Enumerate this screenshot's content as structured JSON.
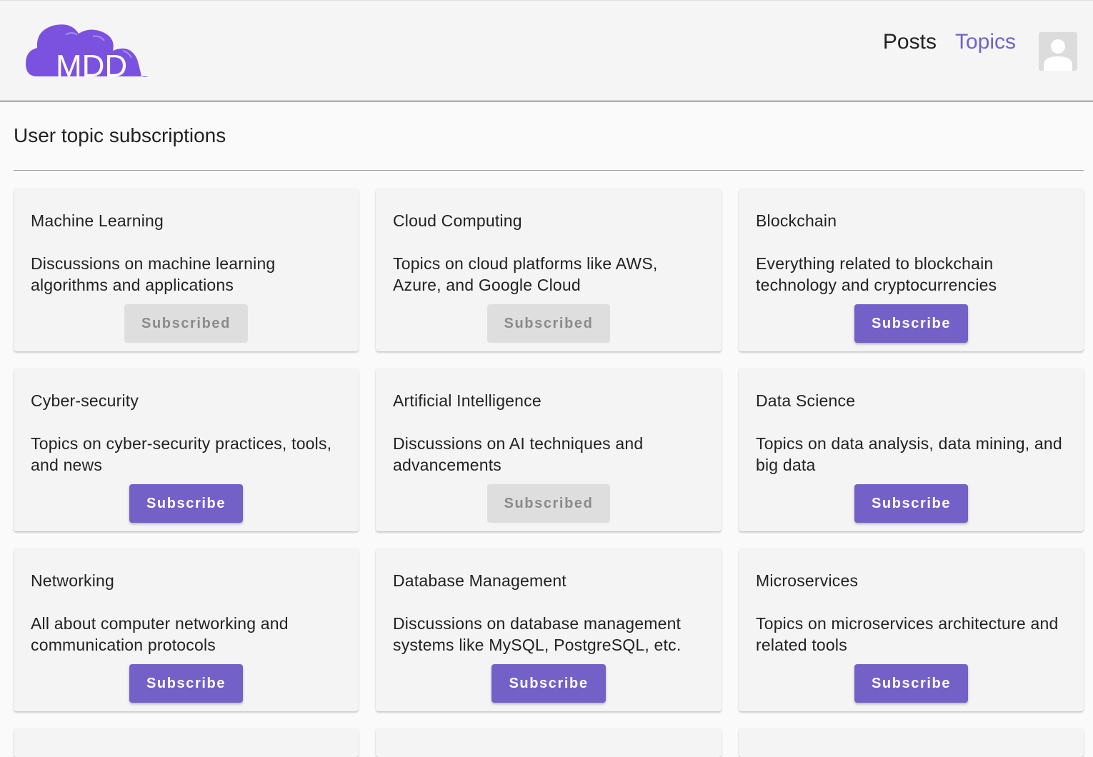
{
  "header": {
    "logo_text": "MDD",
    "nav": {
      "posts_label": "Posts",
      "topics_label": "Topics"
    },
    "brand_color": "#7361c8"
  },
  "page": {
    "title": "User topic subscriptions"
  },
  "topics": [
    {
      "title": "Machine Learning",
      "description": "Discussions on machine learning algorithms and applications",
      "button_label": "Subscribed",
      "subscribed": true
    },
    {
      "title": "Cloud Computing",
      "description": "Topics on cloud platforms like AWS, Azure, and Google Cloud",
      "button_label": "Subscribed",
      "subscribed": true
    },
    {
      "title": "Blockchain",
      "description": "Everything related to blockchain technology and cryptocurrencies",
      "button_label": "Subscribe",
      "subscribed": false
    },
    {
      "title": "Cyber-security",
      "description": "Topics on cyber-security practices, tools, and news",
      "button_label": "Subscribe",
      "subscribed": false
    },
    {
      "title": "Artificial Intelligence",
      "description": "Discussions on AI techniques and advancements",
      "button_label": "Subscribed",
      "subscribed": true
    },
    {
      "title": "Data Science",
      "description": "Topics on data analysis, data mining, and big data",
      "button_label": "Subscribe",
      "subscribed": false
    },
    {
      "title": "Networking",
      "description": "All about computer networking and communication protocols",
      "button_label": "Subscribe",
      "subscribed": false
    },
    {
      "title": "Database Management",
      "description": "Discussions on database management systems like MySQL, PostgreSQL, etc.",
      "button_label": "Subscribe",
      "subscribed": false
    },
    {
      "title": "Microservices",
      "description": "Topics on microservices architecture and related tools",
      "button_label": "Subscribe",
      "subscribed": false
    }
  ],
  "icons": {
    "avatar": "person-icon"
  }
}
